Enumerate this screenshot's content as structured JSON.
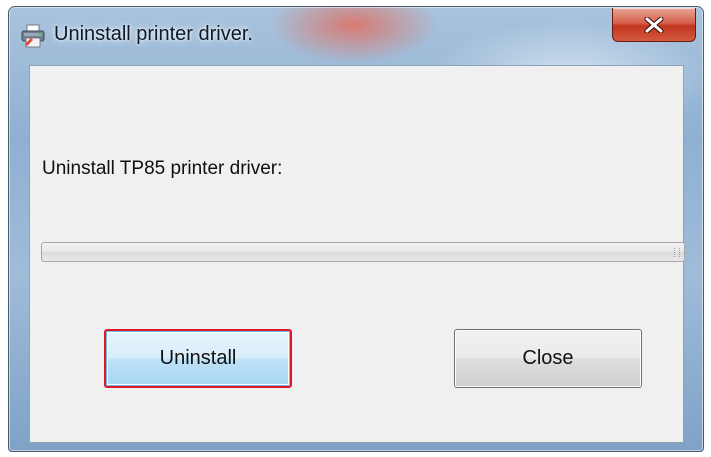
{
  "window": {
    "title": "Uninstall printer driver.",
    "app_icon": "printer-icon",
    "close_icon": "close-icon"
  },
  "dialog": {
    "prompt": "Uninstall TP85 printer driver:",
    "progress_fraction": 0
  },
  "buttons": {
    "uninstall_label": "Uninstall",
    "close_label": "Close"
  },
  "colors": {
    "highlight_border": "#e0192a",
    "close_button": "#c1361f"
  }
}
